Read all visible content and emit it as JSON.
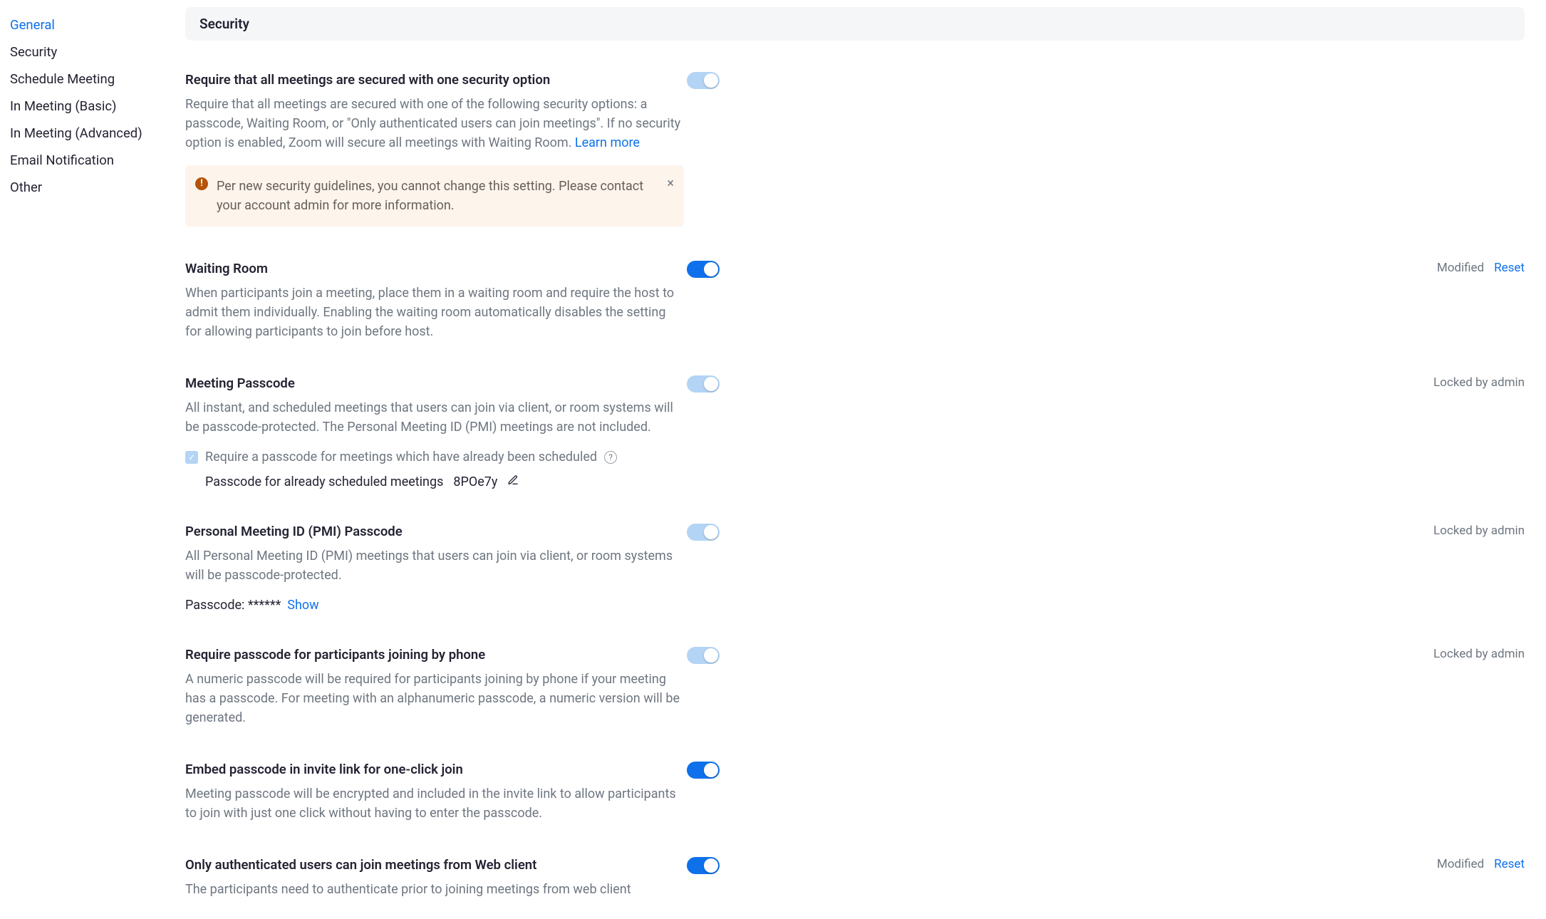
{
  "sidebar": {
    "items": [
      {
        "label": "General",
        "active": true
      },
      {
        "label": "Security"
      },
      {
        "label": "Schedule Meeting"
      },
      {
        "label": "In Meeting (Basic)"
      },
      {
        "label": "In Meeting (Advanced)"
      },
      {
        "label": "Email Notification"
      },
      {
        "label": "Other"
      }
    ]
  },
  "section_header": "Security",
  "labels": {
    "modified": "Modified",
    "reset": "Reset",
    "locked": "Locked by admin",
    "learn_more": "Learn more",
    "show": "Show"
  },
  "settings": {
    "require_security": {
      "title": "Require that all meetings are secured with one security option",
      "desc": "Require that all meetings are secured with one of the following security options: a passcode, Waiting Room, or \"Only authenticated users can join meetings\". If no security option is enabled, Zoom will secure all meetings with Waiting Room. ",
      "notice": "Per new security guidelines, you cannot change this setting. Please contact your account admin for more information."
    },
    "waiting_room": {
      "title": "Waiting Room",
      "desc": "When participants join a meeting, place them in a waiting room and require the host to admit them individually. Enabling the waiting room automatically disables the setting for allowing participants to join before host."
    },
    "meeting_passcode": {
      "title": "Meeting Passcode",
      "desc": "All instant, and scheduled meetings that users can join via client, or room systems will be passcode-protected. The Personal Meeting ID (PMI) meetings are not included.",
      "sub_check_label": "Require a passcode for meetings which have already been scheduled",
      "sub_row_label": "Passcode for already scheduled meetings",
      "sub_row_value": "8POe7y"
    },
    "pmi_passcode": {
      "title": "Personal Meeting ID (PMI) Passcode",
      "desc": "All Personal Meeting ID (PMI) meetings that users can join via client, or room systems will be passcode-protected.",
      "passcode_label": "Passcode: ",
      "passcode_masked": "******"
    },
    "phone_passcode": {
      "title": "Require passcode for participants joining by phone",
      "desc": "A numeric passcode will be required for participants joining by phone if your meeting has a passcode. For meeting with an alphanumeric passcode, a numeric version will be generated."
    },
    "embed_passcode": {
      "title": "Embed passcode in invite link for one-click join",
      "desc": "Meeting passcode will be encrypted and included in the invite link to allow participants to join with just one click without having to enter the passcode."
    },
    "auth_web": {
      "title": "Only authenticated users can join meetings from Web client",
      "desc": "The participants need to authenticate prior to joining meetings from web client"
    }
  }
}
